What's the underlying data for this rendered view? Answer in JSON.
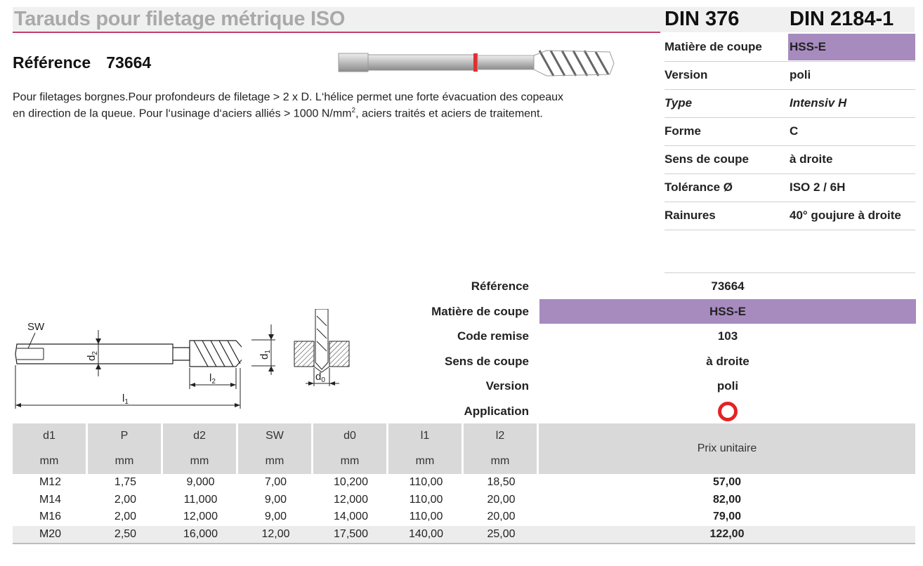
{
  "header": {
    "title": "Tarauds pour filetage métrique ISO",
    "din1": "DIN 376",
    "din2": "DIN 2184-1"
  },
  "reference": {
    "label": "Référence",
    "number": "73664"
  },
  "description": {
    "line1": "Pour filetages borgnes.Pour profondeurs de filetage > 2 x D. L‘hélice permet une forte évacuation des copeaux",
    "line2_a": "en direction de la queue. Pour l‘usinage d‘aciers alliés > 1000 N/mm",
    "line2_sup": "2",
    "line2_b": ", aciers traités et aciers de traitement."
  },
  "properties": [
    {
      "key": "Matière de coupe",
      "value": "HSS-E"
    },
    {
      "key": "Version",
      "value": "poli"
    },
    {
      "key": "Type",
      "value": "Intensiv H"
    },
    {
      "key": "Forme",
      "value": "C"
    },
    {
      "key": "Sens de coupe",
      "value": "à droite"
    },
    {
      "key": "Tolérance Ø",
      "value": "ISO 2 / 6H"
    },
    {
      "key": "Rainures",
      "value": "40° goujure à droite"
    }
  ],
  "drawing_labels": {
    "sw": "SW",
    "d2": "d",
    "d2_sub": "2",
    "d1": "d",
    "d1_sub": "1",
    "l2": "l",
    "l2_sub": "2",
    "l1": "l",
    "l1_sub": "1",
    "d0": "d",
    "d0_sub": "0"
  },
  "specs": [
    {
      "key": "Référence",
      "value": "73664"
    },
    {
      "key": "Matière de coupe",
      "value": "HSS-E"
    },
    {
      "key": "Code remise",
      "value": "103"
    },
    {
      "key": "Sens de coupe",
      "value": "à droite"
    },
    {
      "key": "Version",
      "value": "poli"
    },
    {
      "key": "Application",
      "value": ""
    }
  ],
  "table": {
    "headers": [
      "d1",
      "P",
      "d2",
      "SW",
      "d0",
      "l1",
      "l2"
    ],
    "units": [
      "mm",
      "mm",
      "mm",
      "mm",
      "mm",
      "mm",
      "mm"
    ],
    "price_header": "Prix unitaire",
    "rows": [
      [
        "M12",
        "1,75",
        "9,000",
        "7,00",
        "10,200",
        "110,00",
        "18,50",
        "57,00"
      ],
      [
        "M14",
        "2,00",
        "11,000",
        "9,00",
        "12,000",
        "110,00",
        "20,00",
        "82,00"
      ],
      [
        "M16",
        "2,00",
        "12,000",
        "9,00",
        "14,000",
        "110,00",
        "20,00",
        "79,00"
      ],
      [
        "M20",
        "2,50",
        "16,000",
        "12,00",
        "17,500",
        "140,00",
        "25,00",
        "122,00"
      ]
    ]
  },
  "colors": {
    "highlight": "#a78bbf",
    "accent_line": "#c0406a",
    "application_ring": "#e52222"
  }
}
